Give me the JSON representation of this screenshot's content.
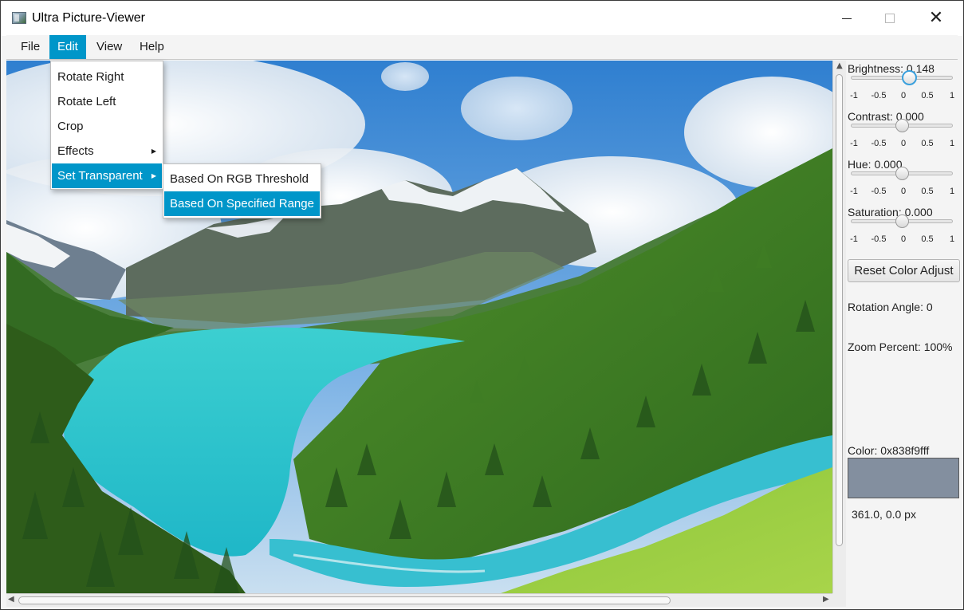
{
  "window": {
    "title": "Ultra Picture-Viewer",
    "icon": "picture-viewer-app-icon"
  },
  "menubar": {
    "items": [
      "File",
      "Edit",
      "View",
      "Help"
    ],
    "active": "Edit"
  },
  "edit_menu": {
    "items": [
      "Rotate Right",
      "Rotate Left",
      "Crop",
      "Effects",
      "Set Transparent"
    ],
    "active": "Set Transparent",
    "has_submenu": [
      "Effects",
      "Set Transparent"
    ]
  },
  "transparent_submenu": {
    "items": [
      "Based On RGB Threshold",
      "Based On Specified Range"
    ],
    "highlighted": "Based On Specified Range"
  },
  "adjustments": {
    "brightness": {
      "label": "Brightness: 0.148",
      "value": 0.148
    },
    "contrast": {
      "label": "Contrast: 0.000",
      "value": 0.0
    },
    "hue": {
      "label": "Hue: 0.000",
      "value": 0.0
    },
    "saturation": {
      "label": "Saturation: 0.000",
      "value": 0.0
    },
    "tick_labels": [
      "-1",
      "-0.5",
      "0",
      "0.5",
      "1"
    ],
    "range": [
      -1,
      1
    ],
    "reset_label": "Reset Color Adjust"
  },
  "info": {
    "rotation": "Rotation Angle: 0",
    "zoom": "Zoom Percent: 100%",
    "color_label": "Color: 0x838f9fff",
    "color_hex": "#838f9f",
    "coords": "361.0, 0.0 px"
  },
  "colors": {
    "accent": "#0096c9",
    "slider_focus": "#3aa0dd"
  }
}
